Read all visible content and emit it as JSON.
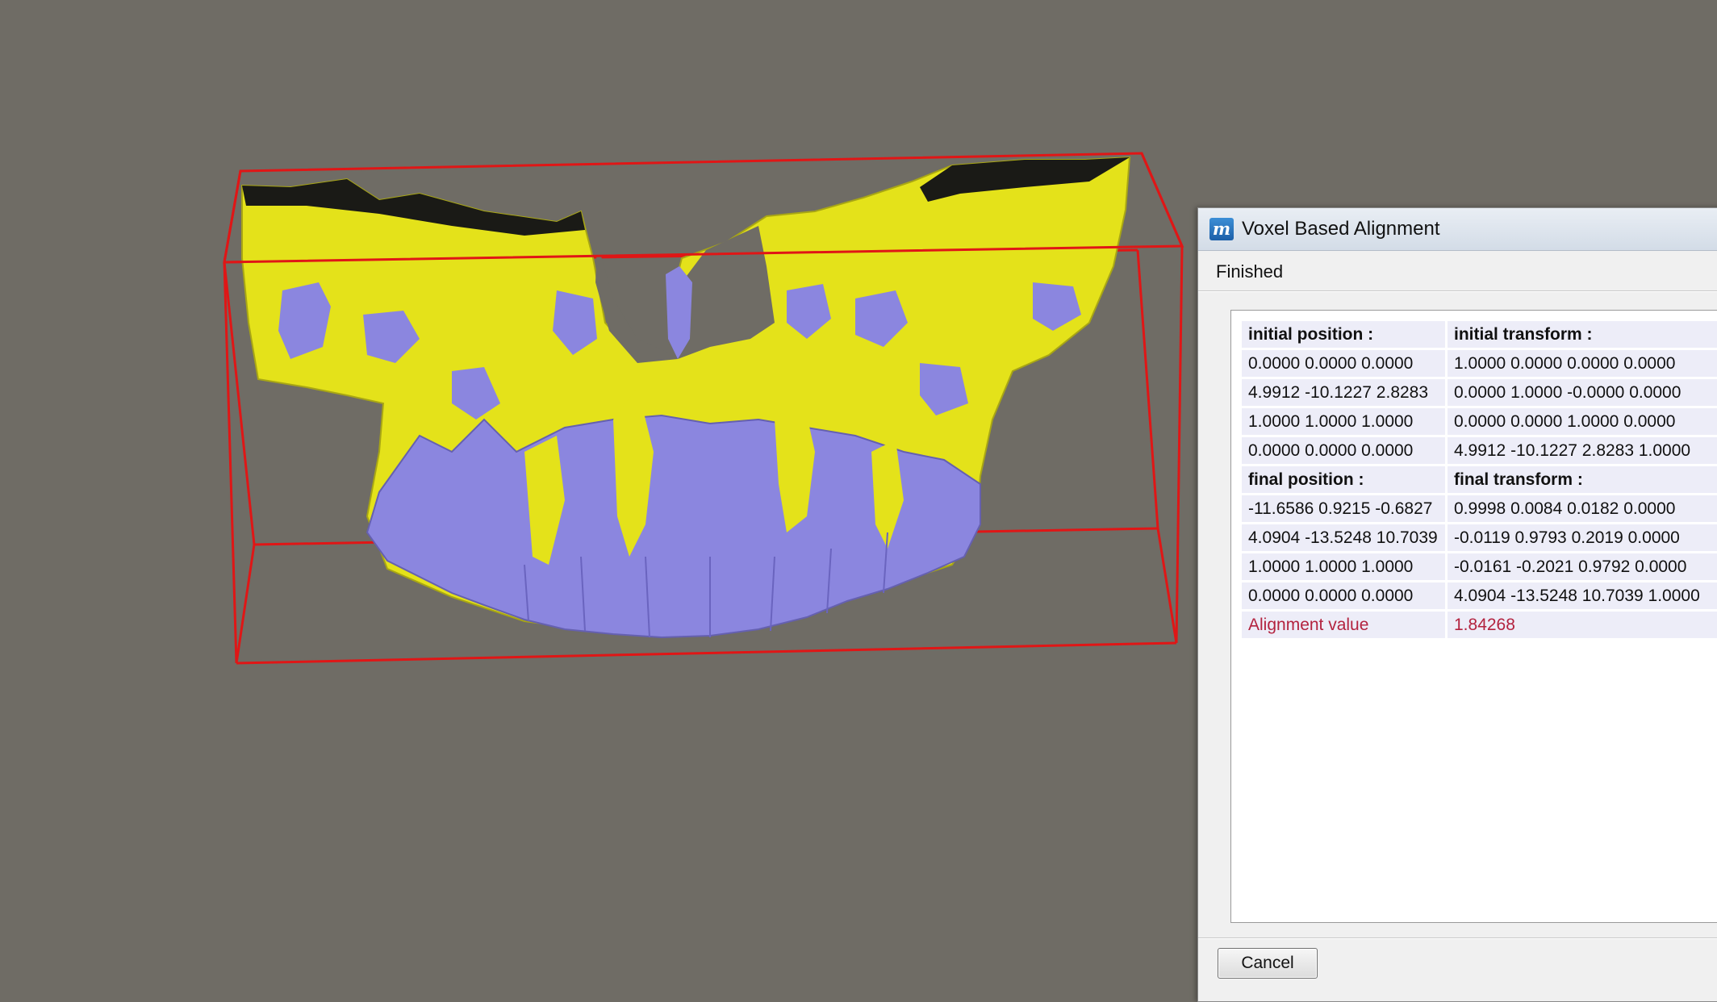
{
  "dialog": {
    "title": "Voxel Based Alignment",
    "app_icon": "m",
    "status": "Finished",
    "cancel_label": "Cancel"
  },
  "results": {
    "rows": [
      {
        "type": "head",
        "left": "initial position :",
        "right": "initial transform :"
      },
      {
        "type": "value",
        "left": "0.0000 0.0000 0.0000",
        "right": "1.0000 0.0000 0.0000 0.0000"
      },
      {
        "type": "value",
        "left": "4.9912 -10.1227 2.8283",
        "right": "0.0000 1.0000 -0.0000 0.0000"
      },
      {
        "type": "value",
        "left": "1.0000 1.0000 1.0000",
        "right": "0.0000 0.0000 1.0000 0.0000"
      },
      {
        "type": "value",
        "left": "0.0000 0.0000 0.0000",
        "right": "4.9912 -10.1227 2.8283 1.0000"
      },
      {
        "type": "head",
        "left": "final position :",
        "right": "final transform :"
      },
      {
        "type": "value",
        "left": "-11.6586 0.9215 -0.6827",
        "right": "0.9998 0.0084 0.0182 0.0000"
      },
      {
        "type": "value",
        "left": "4.0904 -13.5248 10.7039",
        "right": "-0.0119 0.9793 0.2019 0.0000"
      },
      {
        "type": "value",
        "left": "1.0000 1.0000 1.0000",
        "right": "-0.0161 -0.2021 0.9792 0.0000"
      },
      {
        "type": "value",
        "left": "0.0000 0.0000 0.0000",
        "right": "4.0904 -13.5248 10.7039 1.0000"
      },
      {
        "type": "alignment",
        "left": "Alignment value",
        "right": "1.84268"
      }
    ]
  },
  "colors": {
    "background": "#6f6c65",
    "bounding_box": "#e01616",
    "model_a": "#e4e21a",
    "model_b": "#8b86df",
    "alignment_text": "#b3233f"
  }
}
